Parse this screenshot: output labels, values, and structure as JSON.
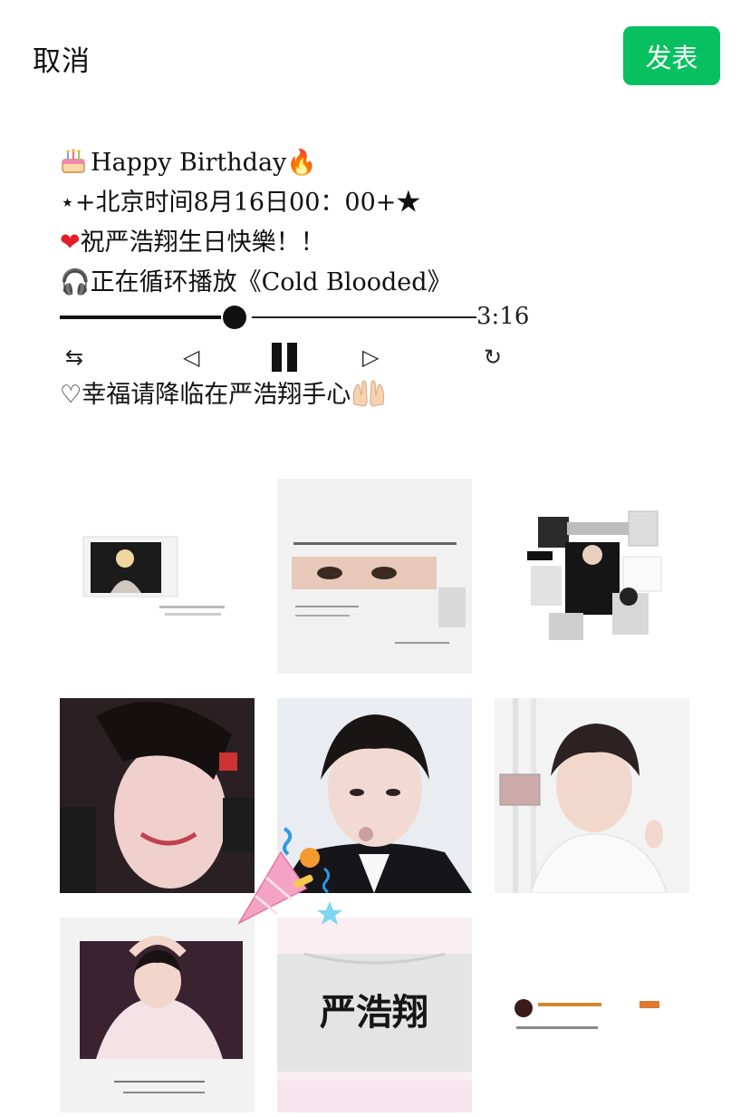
{
  "topbar": {
    "cancel_label": "取消",
    "publish_label": "发表"
  },
  "colors": {
    "publish_bg": "#07c160"
  },
  "post": {
    "line1": "Happy Birthday",
    "line2": "⋆+北京时间8月16日00：00+★",
    "line3": "祝严浩翔生日快樂！！",
    "line4": "正在循环播放《Cold Blooded》",
    "line6": "♡幸福请降临在严浩翔手心",
    "emojis": {
      "cake": "cake-icon",
      "fire": "🔥",
      "heart": "❤",
      "headphones": "🎧"
    }
  },
  "player": {
    "time": "3:16",
    "progress_fraction": 0.36,
    "controls": {
      "shuffle": "⇆",
      "prev": "◁",
      "next": "▷",
      "repeat": "↻"
    }
  },
  "photos": {
    "count": 9,
    "captions": {
      "photo8_text": "严浩翔"
    }
  }
}
